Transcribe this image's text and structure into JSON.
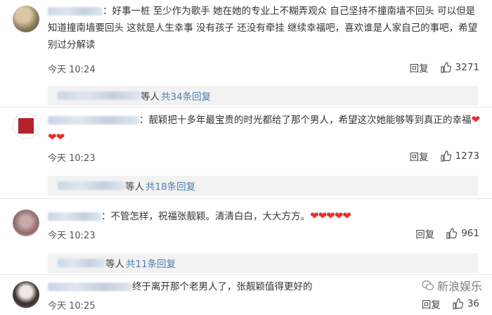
{
  "comments": [
    {
      "text": "：好事一桩 至少作为歌手 她在她的专业上不糊弄观众 自己坚持不撞南墙不回头 可以但是知道撞南墙要回头 这就是人生幸事 没有孩子 还没有牵挂 继续幸福吧，喜欢谁是人家自己的事吧，希望别过分解读",
      "time": "今天 10:24",
      "reply_label": "回复",
      "likes": "3271",
      "replies_prefix": "等人",
      "replies_link": "共34条回复"
    },
    {
      "text": "：靓颖把十多年最宝贵的时光都给了那个男人，希望这次她能够等到真正的幸福",
      "hearts": "❤❤❤",
      "time": "今天 10:23",
      "reply_label": "回复",
      "likes": "1273",
      "replies_prefix": "等人",
      "replies_link": "共18条回复"
    },
    {
      "text": "：不管怎样，祝福张靓颖。清清白白，大大方方。",
      "hearts": "❤❤❤❤❤",
      "time": "今天 10:23",
      "reply_label": "回复",
      "likes": "961",
      "replies_prefix": "等人",
      "replies_link": "共11条回复"
    },
    {
      "text": "终于离开那个老男人了，张靓颖值得更好的",
      "time": "今天 10:25",
      "reply_label": "回复",
      "likes": "36"
    }
  ],
  "watermark": "新浪娱乐",
  "colors": {
    "link": "#4c7db5",
    "heart": "#e8302b",
    "reply_bg": "#f2f2f2"
  }
}
